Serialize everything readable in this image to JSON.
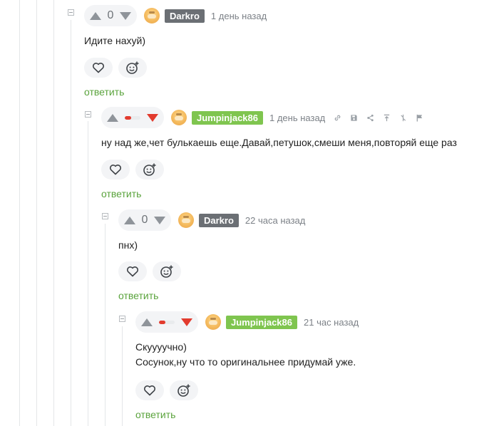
{
  "comments": [
    {
      "score": "0",
      "author": "Darkro",
      "time": "1 день назад",
      "lines": [
        "Идите нахуй)"
      ],
      "reply_label": "ответить"
    },
    {
      "rating_fraction": 0.4,
      "author": "Jumpinjack86",
      "time": "1 день назад",
      "lines": [
        "ну над же,чет булькаешь еще.Давай,петушок,смеши меня,повторяй еще раз"
      ],
      "reply_label": "ответить"
    },
    {
      "score": "0",
      "author": "Darkro",
      "time": "22 часа назад",
      "lines": [
        "пнх)"
      ],
      "reply_label": "ответить"
    },
    {
      "rating_fraction": 0.4,
      "author": "Jumpinjack86",
      "time": "21 час назад",
      "lines": [
        "Скуууучно)",
        "Сосунок,ну что то оригинальнее придумай уже."
      ],
      "reply_label": "ответить"
    }
  ],
  "colors": {
    "accent_green": "#7fc54f",
    "reply_green": "#5aa33c",
    "nick_gray": "#6b6f74",
    "downvote_red": "#e23b2e"
  },
  "icons": {
    "tools": [
      "link-icon",
      "save-icon",
      "share-icon",
      "scroll-up-icon",
      "branch-icon",
      "flag-icon"
    ],
    "actions": [
      "heart-icon",
      "emoji-add-icon"
    ]
  }
}
